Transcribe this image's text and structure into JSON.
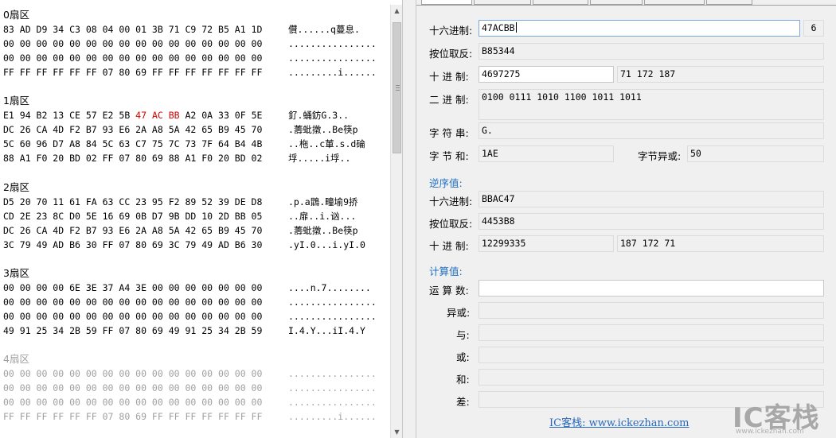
{
  "hex": {
    "sectors": [
      {
        "title": "0扇区",
        "rows": [
          {
            "bytes": "83 AD D9 34 C3 08 04 00 01 3B 71 C9 72 B5 A1 1D",
            "ascii": "儹......q蔓息."
          },
          {
            "bytes": "00 00 00 00 00 00 00 00 00 00 00 00 00 00 00 00",
            "ascii": "................"
          },
          {
            "bytes": "00 00 00 00 00 00 00 00 00 00 00 00 00 00 00 00",
            "ascii": "................"
          },
          {
            "bytes": "FF FF FF FF FF FF 07 80 69 FF FF FF FF FF FF FF",
            "ascii": ".........i......"
          }
        ]
      },
      {
        "title": "1扇区",
        "rows": [
          {
            "bytes_pre": "E1 94 B2 13 CE 57 E2 5B ",
            "bytes_hl": "47 AC BB",
            "bytes_post": " A2 0A 33 0F 5E",
            "ascii": "釕.蛹鈁G.3.."
          },
          {
            "bytes": "DC 26 CA 4D F2 B7 93 E6 2A A8 5A 42 65 B9 45 70",
            "ascii": ".薵蚍撴..Be筷p"
          },
          {
            "bytes": "5C 60 96 D7 A8 84 5C 63 C7 75 7C 73 7F 64 B4 4B",
            "ascii": "..柂..c莗.s.d碖"
          },
          {
            "bytes": "88 A1 F0 20 BD 02 FF 07 80 69 88 A1 F0 20 BD 02",
            "ascii": "垺.....i垺.."
          }
        ]
      },
      {
        "title": "2扇区",
        "rows": [
          {
            "bytes": "D5 20 70 11 61 FA 63 CC 23 95 F2 89 52 39 DE D8",
            "ascii": ".p.a鵾.疃堬9挢"
          },
          {
            "bytes": "CD 2E 23 8C D0 5E 16 69 0B D7 9B DD 10 2D BB 05",
            "ascii": "..扉..i.讻..."
          },
          {
            "bytes": "DC 26 CA 4D F2 B7 93 E6 2A A8 5A 42 65 B9 45 70",
            "ascii": ".薵蚍撴..Be筷p"
          },
          {
            "bytes": "3C 79 49 AD B6 30 FF 07 80 69 3C 79 49 AD B6 30",
            "ascii": ".yI.0...i.yI.0"
          }
        ]
      },
      {
        "title": "3扇区",
        "rows": [
          {
            "bytes": "00 00 00 00 6E 3E 37 A4 3E 00 00 00 00 00 00 00",
            "ascii": "....n.7........"
          },
          {
            "bytes": "00 00 00 00 00 00 00 00 00 00 00 00 00 00 00 00",
            "ascii": "................"
          },
          {
            "bytes": "00 00 00 00 00 00 00 00 00 00 00 00 00 00 00 00",
            "ascii": "................"
          },
          {
            "bytes": "49 91 25 34 2B 59 FF 07 80 69 49 91 25 34 2B 59",
            "ascii": "I.4.Y...iI.4.Y"
          }
        ]
      },
      {
        "title": "4扇区",
        "rows": [
          {
            "bytes": "00 00 00 00 00 00 00 00 00 00 00 00 00 00 00 00",
            "ascii": "................"
          },
          {
            "bytes": "00 00 00 00 00 00 00 00 00 00 00 00 00 00 00 00",
            "ascii": "................"
          },
          {
            "bytes": "00 00 00 00 00 00 00 00 00 00 00 00 00 00 00 00",
            "ascii": "................"
          },
          {
            "bytes": "FF FF FF FF FF FF 07 80 69 FF FF FF FF FF FF FF",
            "ascii": ".........i......"
          }
        ]
      }
    ]
  },
  "analysis": {
    "hex_label": "十六进制:",
    "hex_value": "47ACBB",
    "hex_len": "6",
    "not_label": "按位取反:",
    "not_value": "B85344",
    "dec_label": "十 进 制:",
    "dec_value": "4697275",
    "dec_bytes": "71 172 187",
    "bin_label": "二 进 制:",
    "bin_value": "0100 0111 1010 1100 1011 1011",
    "str_label": "字 符 串:",
    "str_value": "G.",
    "sum_label": "字 节 和:",
    "sum_value": "1AE",
    "xor_label": "字节异或:",
    "xor_value": "50"
  },
  "reverse": {
    "section": "逆序值:",
    "hex_label": "十六进制:",
    "hex_value": "BBAC47",
    "not_label": "按位取反:",
    "not_value": "4453B8",
    "dec_label": "十 进 制:",
    "dec_value": "12299335",
    "dec_bytes": "187 172 71"
  },
  "calc": {
    "section": "计算值:",
    "operand_label": "运 算 数:",
    "operand_value": "",
    "xor_label": "异或:",
    "and_label": "与:",
    "or_label": "或:",
    "add_label": "和:",
    "sub_label": "差:"
  },
  "footer": {
    "link": "IC客栈: www.ickezhan.com",
    "watermark_big": "IC客栈",
    "watermark_small": "www.ickezhan.com"
  }
}
